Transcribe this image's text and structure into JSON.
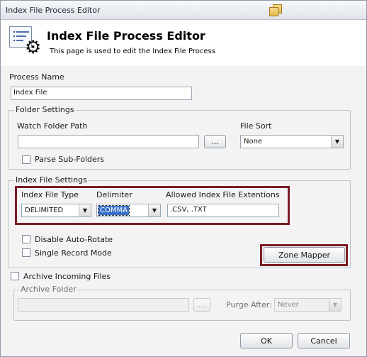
{
  "window": {
    "title": "Index File Process Editor"
  },
  "header": {
    "title": "Index File Process Editor",
    "subtitle": "This page is used to edit the Index File Process"
  },
  "process_name": {
    "label": "Process Name",
    "value": "Index File"
  },
  "folder_settings": {
    "legend": "Folder Settings",
    "watch_folder_label": "Watch Folder Path",
    "watch_folder_value": "",
    "browse_label": "...",
    "file_sort_label": "File Sort",
    "file_sort_value": "None",
    "parse_subfolders_label": "Parse Sub-Folders",
    "parse_subfolders_checked": false
  },
  "index_file_settings": {
    "legend": "Index File Settings",
    "type_label": "Index File Type",
    "type_value": "DELIMITED",
    "delimiter_label": "Delimiter",
    "delimiter_value": "COMMA",
    "extensions_label": "Allowed Index File Extentions",
    "extensions_value": ".CSV, .TXT",
    "disable_autorotate_label": "Disable Auto-Rotate",
    "disable_autorotate_checked": false,
    "single_record_label": "Single Record Mode",
    "single_record_checked": false,
    "zone_mapper_label": "Zone Mapper"
  },
  "archive": {
    "checkbox_label": "Archive Incoming Files",
    "checked": false,
    "folder_legend": "Archive Folder",
    "folder_value": "",
    "browse_label": "...",
    "purge_label": "Purge After:",
    "purge_value": "Never"
  },
  "footer": {
    "ok_label": "OK",
    "cancel_label": "Cancel"
  },
  "colors": {
    "highlight": "#7b1b24",
    "selection": "#3a72c9"
  }
}
